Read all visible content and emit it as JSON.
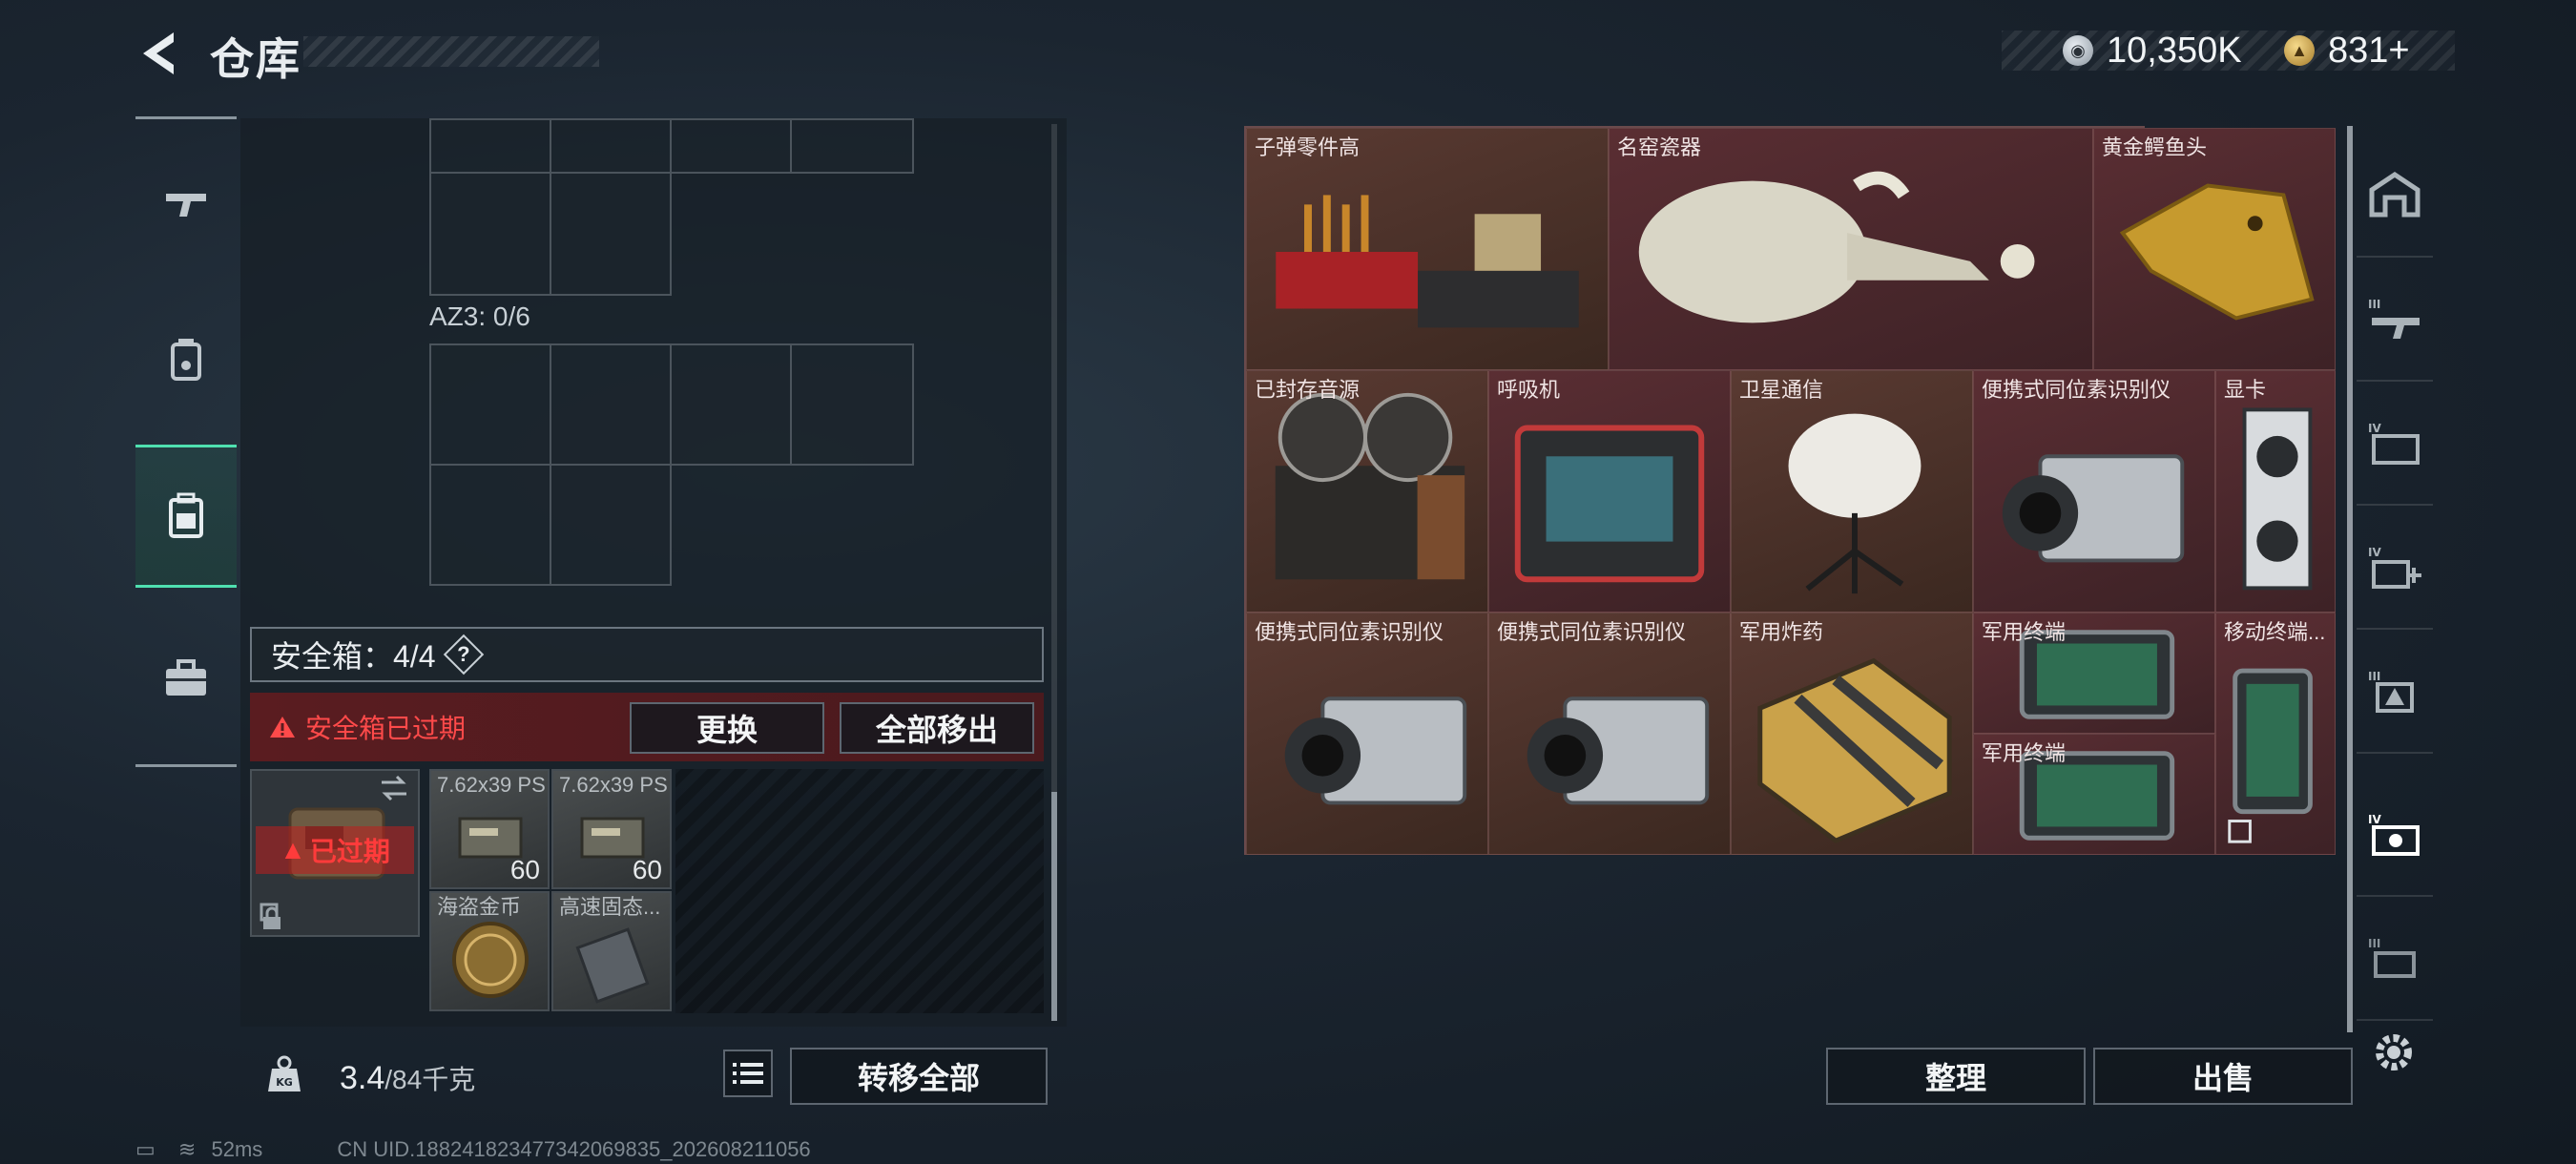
{
  "header": {
    "title": "仓库",
    "currency_silver": "10,350K",
    "currency_gold": "831+"
  },
  "left_nav": [
    "weapon-icon",
    "armor-icon",
    "backpack-icon",
    "case-icon"
  ],
  "container": {
    "az_label": "AZ3: 0/6"
  },
  "safe_box": {
    "label": "安全箱：4/4",
    "help": "?",
    "expired_warning": "安全箱已过期",
    "replace_button": "更换",
    "move_all_out_button": "全部移出",
    "case_expired": "已过期"
  },
  "safe_items": [
    {
      "name": "7.62x39 PS",
      "qty": "60"
    },
    {
      "name": "7.62x39 PS",
      "qty": "60"
    },
    {
      "name": "海盗金币",
      "qty": ""
    },
    {
      "name": "高速固态...",
      "qty": ""
    }
  ],
  "weight": {
    "current": "3.4",
    "max": "/84千克"
  },
  "transfer_all_button": "转移全部",
  "stash_items": [
    "子弹零件高",
    "名窑瓷器",
    "黄金鳄鱼头",
    "已封存音源",
    "呼吸机",
    "卫星通信",
    "便携式同位素识别仪",
    "显卡",
    "便携式同位素识别仪",
    "便携式同位素识别仪",
    "军用炸药",
    "军用终端",
    "移动终端...",
    "军用终端"
  ],
  "stash_buttons": {
    "sort": "整理",
    "sell": "出售"
  },
  "status": {
    "ping": "52ms",
    "uid": "CN UID.18824182347734206983­5_202608211056"
  },
  "colors": {
    "accent": "#4fe0b0",
    "warning": "#ff4a4a",
    "stash_bg": "#4b2a2d"
  }
}
